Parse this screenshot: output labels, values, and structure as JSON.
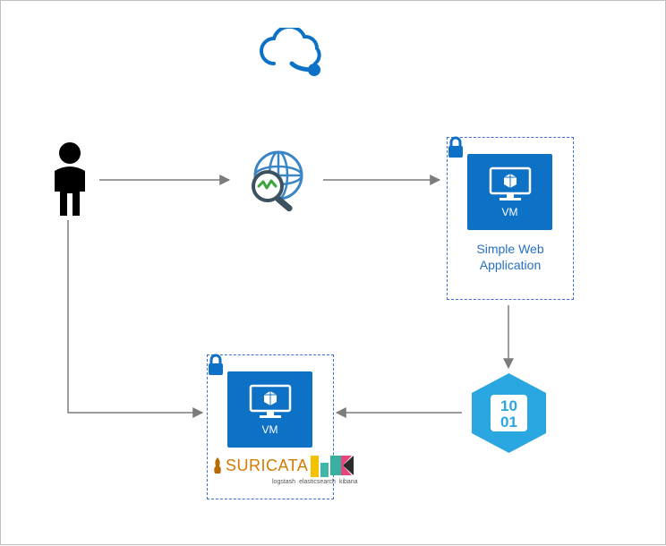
{
  "nodes": {
    "cloud": {
      "name": "cloud-icon"
    },
    "user": {
      "name": "user-icon"
    },
    "network_watcher": {
      "name": "network-watcher-icon"
    },
    "web_app_group": {
      "vm_label": "VM",
      "caption": "Simple Web\nApplication"
    },
    "storage": {
      "name": "storage-binary-icon",
      "bits": "10\n01"
    },
    "ids_group": {
      "vm_label": "VM",
      "suricata_label": "SURICATA",
      "lek_sub": [
        "logstash",
        "elasticsearch",
        "kibana"
      ]
    }
  },
  "arrows": [
    {
      "from": "user",
      "to": "network_watcher"
    },
    {
      "from": "network_watcher",
      "to": "web_app_group"
    },
    {
      "from": "web_app_group",
      "to": "storage"
    },
    {
      "from": "storage",
      "to": "ids_group"
    },
    {
      "from": "user",
      "to": "ids_group"
    }
  ]
}
